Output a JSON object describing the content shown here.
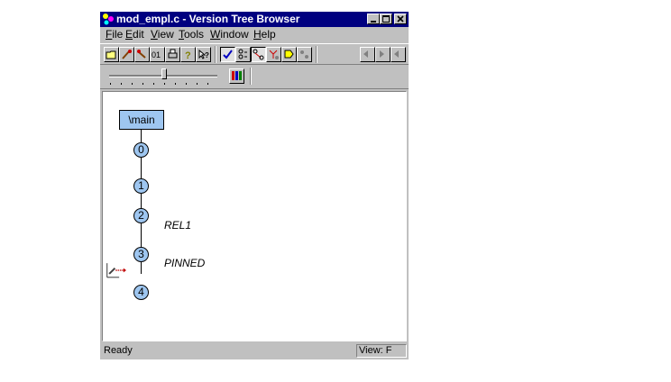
{
  "window": {
    "title": "mod_empl.c - Version Tree Browser"
  },
  "menu": [
    {
      "pre": "",
      "ul": "F",
      "post": "ile"
    },
    {
      "pre": "",
      "ul": "E",
      "post": "dit"
    },
    {
      "pre": "",
      "ul": "V",
      "post": "iew"
    },
    {
      "pre": "",
      "ul": "T",
      "post": "ools"
    },
    {
      "pre": "",
      "ul": "W",
      "post": "indow"
    },
    {
      "pre": "",
      "ul": "H",
      "post": "elp"
    }
  ],
  "tree": {
    "branch": "\\main",
    "versions": [
      "0",
      "1",
      "2",
      "3",
      "4"
    ],
    "labels": {
      "v2": "REL1",
      "v3": "PINNED"
    }
  },
  "status": {
    "text": "Ready",
    "view": "View: F"
  },
  "icons": {
    "app": "version-tree-app-icon",
    "merge": "merge-arrow-icon"
  },
  "colors": {
    "titlebar": "#000080",
    "version_fill": "#9ec6f0",
    "chrome": "#c0c0c0"
  }
}
